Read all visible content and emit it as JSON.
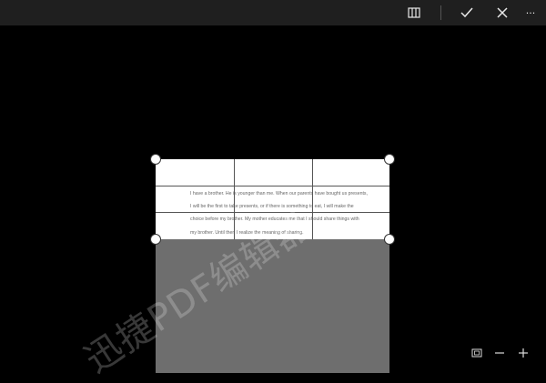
{
  "toolbar": {
    "icons": [
      "split-view-icon",
      "check-icon",
      "close-icon",
      "more-icon"
    ],
    "more_label": "···"
  },
  "document": {
    "lines": [
      "I have a brother. He is younger than me. When our parents have bought us presents,",
      "I will be the first to take presents, or if there is something to eat, I will make the",
      "choice before my brother. My mother educates me that I should share things with",
      "my brother. Until then I realize the meaning of sharing."
    ]
  },
  "watermark": {
    "text": "迅捷PDF编辑器"
  },
  "bottom_controls": {
    "icons": [
      "fit-screen-icon",
      "zoom-out-icon",
      "zoom-in-icon"
    ]
  },
  "colors": {
    "toolbar_bg": "#1f1f1f",
    "stage_bg": "#000000",
    "page_shade": "#6e6e6e",
    "handle": "#ffffff"
  }
}
